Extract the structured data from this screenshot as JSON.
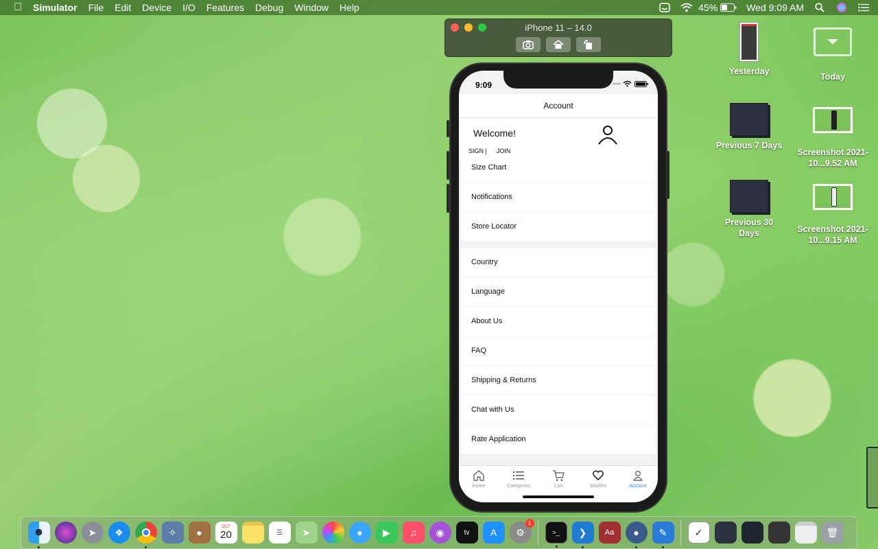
{
  "menubar": {
    "app_name": "Simulator",
    "menus": [
      "File",
      "Edit",
      "Device",
      "I/O",
      "Features",
      "Debug",
      "Window",
      "Help"
    ],
    "battery": "45%",
    "clock": "Wed 9:09 AM"
  },
  "simulator": {
    "title": "iPhone 11 – 14.0"
  },
  "phone": {
    "status_time": "9:09",
    "header_title": "Account",
    "welcome": "Welcome!",
    "sign_in": "SIGN |",
    "join": "JOIN",
    "menu_items": [
      "Size Chart",
      "Notifications",
      "Store Locator"
    ],
    "settings_items": [
      "Country",
      "Language",
      "About Us",
      "FAQ",
      "Shipping & Returns",
      "Chat with Us",
      "Rate Application"
    ],
    "tabs": [
      {
        "label": "Home",
        "icon": "home-icon"
      },
      {
        "label": "Categories",
        "icon": "list-icon"
      },
      {
        "label": "Cart",
        "icon": "cart-icon"
      },
      {
        "label": "Wishlist",
        "icon": "heart-icon"
      },
      {
        "label": "Account",
        "icon": "person-icon",
        "active": true
      }
    ],
    "active_color": "#1a8cff"
  },
  "desktop": {
    "items": [
      {
        "label": "Yesterday"
      },
      {
        "label": "Today"
      },
      {
        "label": "Previous 7 Days"
      },
      {
        "label": "Screenshot 2021-10...9.52 AM"
      },
      {
        "label": "Previous 30 Days"
      },
      {
        "label": "Screenshot 2021-10...9.15 AM"
      }
    ]
  },
  "dock": {
    "calendar_month": "OCT",
    "calendar_day": "20",
    "badge_count": "1"
  }
}
